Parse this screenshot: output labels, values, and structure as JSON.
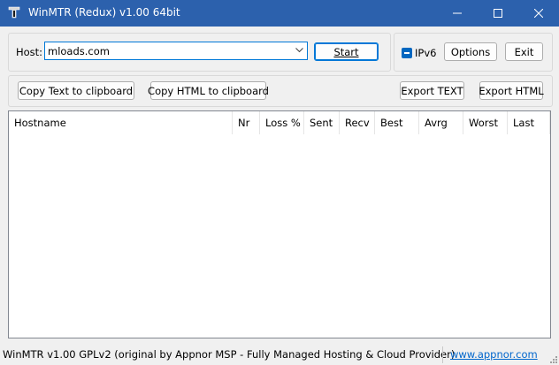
{
  "window": {
    "title": "WinMTR (Redux) v1.00 64bit",
    "controls": {
      "minimize": "minimize-icon",
      "maximize": "maximize-icon",
      "close": "close-icon"
    }
  },
  "host_panel": {
    "host_label": "Host:",
    "host_value": "mloads.com",
    "start_label": "Start"
  },
  "options_panel": {
    "ipv6_label": "IPv6",
    "options_label": "Options",
    "exit_label": "Exit"
  },
  "toolbar": {
    "copy_text_label": "Copy Text to clipboard",
    "copy_html_label": "Copy HTML to clipboard",
    "export_text_label": "Export TEXT",
    "export_html_label": "Export HTML"
  },
  "table": {
    "columns": [
      "Hostname",
      "Nr",
      "Loss %",
      "Sent",
      "Recv",
      "Best",
      "Avrg",
      "Worst",
      "Last"
    ],
    "rows": []
  },
  "status": {
    "text": "WinMTR v1.00 GPLv2 (original by Appnor MSP - Fully Managed Hosting & Cloud Provider)",
    "link": "www.appnor.com"
  },
  "colors": {
    "titlebar": "#2c61ad",
    "accent": "#0078d7",
    "checkbox": "#0067c0",
    "link": "#0066cc"
  }
}
